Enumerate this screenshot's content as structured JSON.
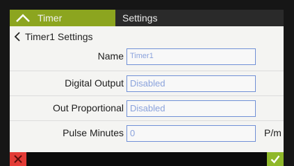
{
  "tabs": {
    "timer_label": "Timer",
    "settings_label": "Settings"
  },
  "breadcrumb": {
    "title": "Timer1 Settings"
  },
  "form": {
    "name": {
      "label": "Name",
      "value": "Timer1"
    },
    "digital_output": {
      "label": "Digital Output",
      "value": "Disabled"
    },
    "out_proportional": {
      "label": "Out Proportional",
      "value": "Disabled"
    },
    "pulse_minutes": {
      "label": "Pulse Minutes",
      "value": "0",
      "unit": "P/m"
    }
  },
  "colors": {
    "accent": "#8ca51f",
    "cancel": "#e23b36",
    "confirm": "#8fb82a",
    "field_border": "#6f8fd6"
  },
  "icons": {
    "tab_timer": "chevron-up-icon",
    "back": "chevron-left-icon",
    "cancel": "close-icon",
    "confirm": "checkmark-icon"
  }
}
